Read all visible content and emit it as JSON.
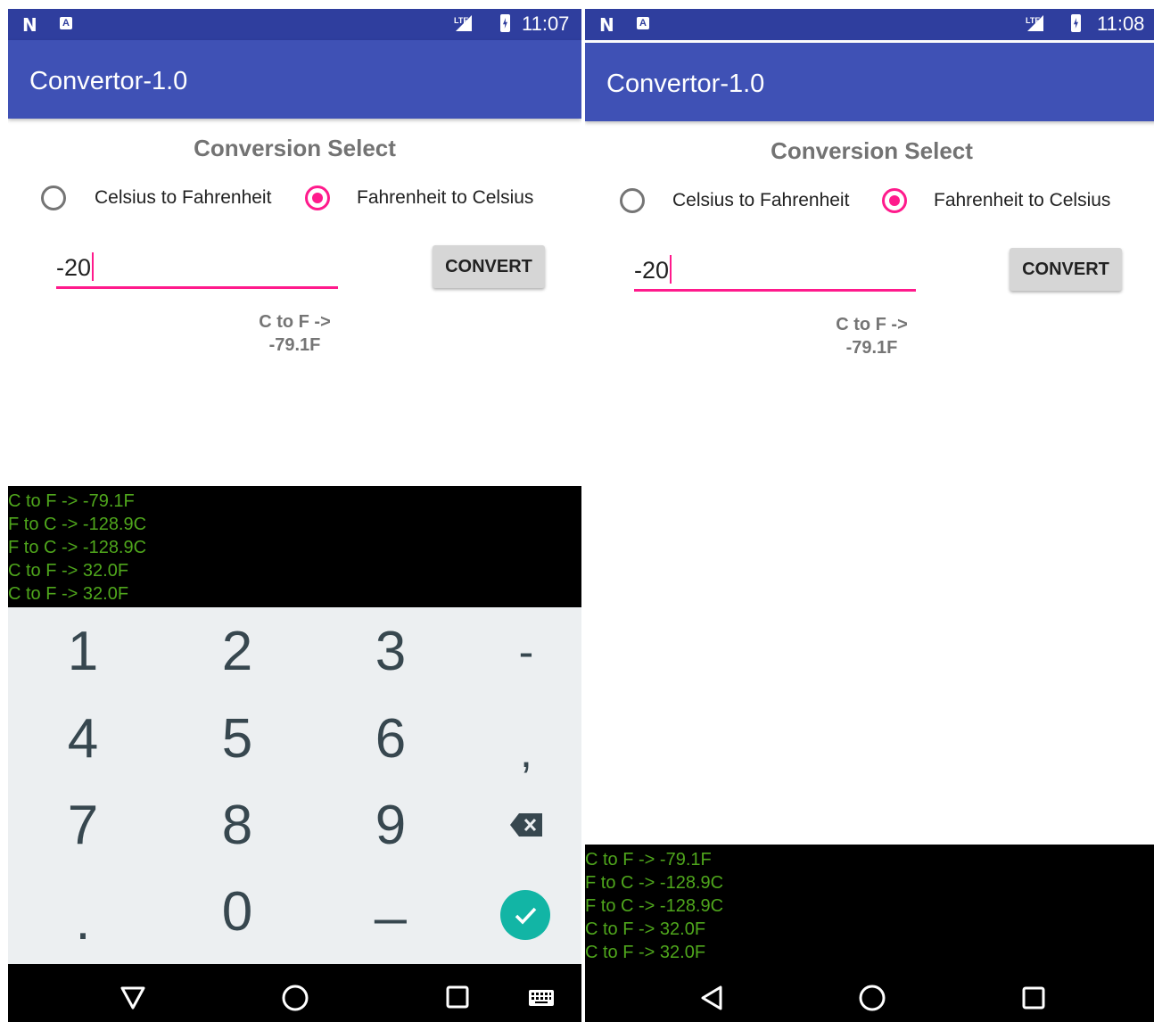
{
  "screens": [
    {
      "status": {
        "time": "11:07",
        "network": "LTE"
      },
      "app_title": "Convertor-1.0",
      "heading": "Conversion Select",
      "radios": [
        {
          "label": "Celsius to Fahrenheit",
          "selected": false
        },
        {
          "label": "Fahrenheit to Celsius",
          "selected": true
        }
      ],
      "input_value": "-20",
      "button_label": "CONVERT",
      "result_line1": "C to F ->",
      "result_line2": "-79.1F",
      "log": [
        "C to F -> -79.1F",
        "F to C -> -128.9C",
        "F to C -> -128.9C",
        "C to F -> 32.0F",
        "C to F -> 32.0F"
      ],
      "keyboard": {
        "keys": [
          "1",
          "2",
          "3",
          "-",
          "4",
          "5",
          "6",
          ",",
          "7",
          "8",
          "9",
          ".",
          "0",
          "_"
        ]
      }
    },
    {
      "status": {
        "time": "11:08",
        "network": "LTE"
      },
      "app_title": "Convertor-1.0",
      "heading": "Conversion Select",
      "radios": [
        {
          "label": "Celsius to Fahrenheit",
          "selected": false
        },
        {
          "label": "Fahrenheit to Celsius",
          "selected": true
        }
      ],
      "input_value": "-20",
      "button_label": "CONVERT",
      "result_line1": "C to F ->",
      "result_line2": "-79.1F",
      "log": [
        "C to F -> -79.1F",
        "F to C -> -128.9C",
        "F to C -> -128.9C",
        "C to F -> 32.0F",
        "C to F -> 32.0F"
      ]
    }
  ],
  "colors": {
    "status_bar": "#2f3e9e",
    "app_bar": "#3f51b5",
    "accent": "#ff1a8c",
    "log_text": "#4fa61c",
    "done_key": "#12b5a5"
  },
  "icons": [
    "n-notification-icon",
    "a-notification-icon",
    "lte-icon",
    "signal-icon",
    "battery-charging-icon",
    "back-icon",
    "home-icon",
    "recents-icon",
    "keyboard-icon",
    "backspace-icon",
    "check-icon"
  ]
}
